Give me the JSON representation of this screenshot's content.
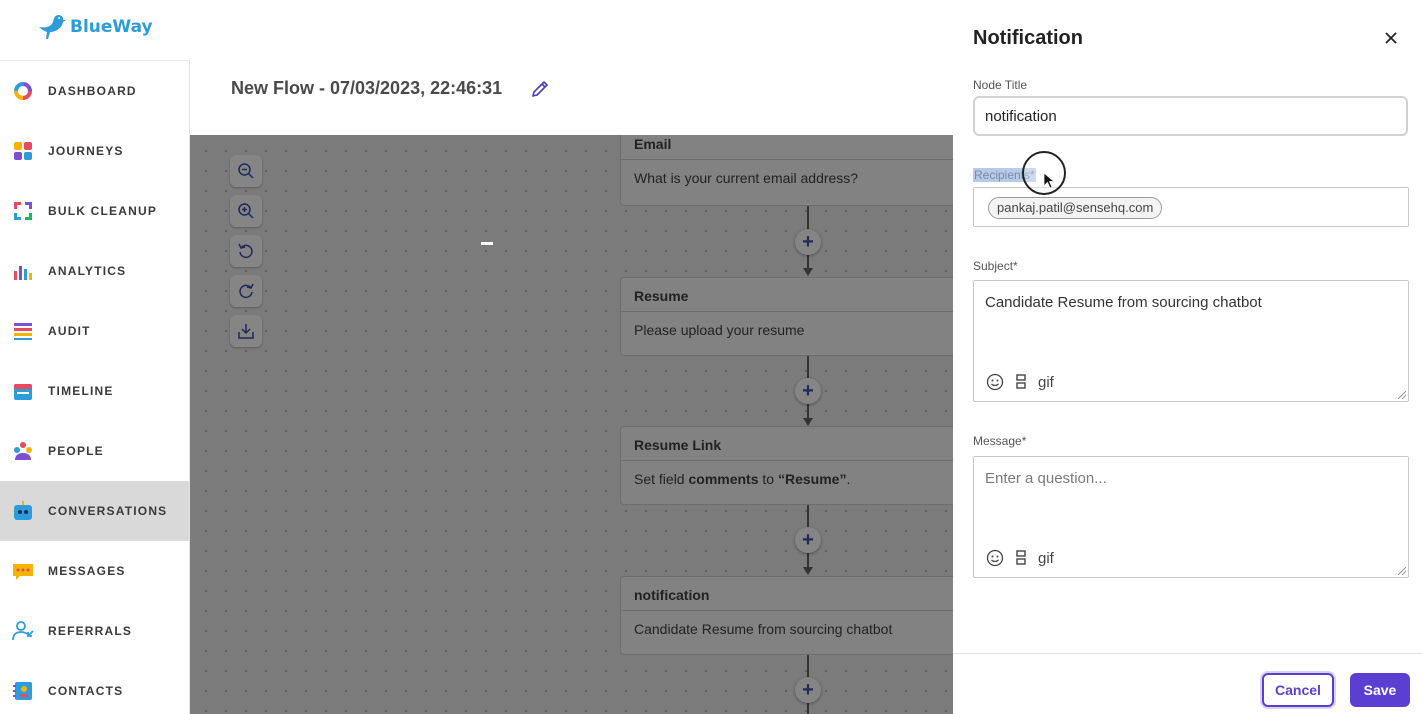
{
  "app": {
    "name": "BlueWay"
  },
  "sidebar": {
    "items": [
      {
        "label": "DASHBOARD",
        "icon": "dashboard-donut-icon"
      },
      {
        "label": "JOURNEYS",
        "icon": "journeys-grid-icon"
      },
      {
        "label": "BULK CLEANUP",
        "icon": "bulk-cleanup-arrows-icon"
      },
      {
        "label": "ANALYTICS",
        "icon": "analytics-bars-icon"
      },
      {
        "label": "AUDIT",
        "icon": "audit-list-icon"
      },
      {
        "label": "TIMELINE",
        "icon": "timeline-calendar-icon"
      },
      {
        "label": "PEOPLE",
        "icon": "people-group-icon"
      },
      {
        "label": "CONVERSATIONS",
        "icon": "conversations-robot-icon",
        "active": true
      },
      {
        "label": "MESSAGES",
        "icon": "messages-bubble-icon"
      },
      {
        "label": "REFERRALS",
        "icon": "referrals-user-icon"
      },
      {
        "label": "CONTACTS",
        "icon": "contacts-book-icon"
      }
    ]
  },
  "header": {
    "flow_title": "New Flow - 07/03/2023, 22:46:31"
  },
  "canvas": {
    "nodes": [
      {
        "title": "Email",
        "body": "What is your current email address?"
      },
      {
        "title": "Resume",
        "body": "Please upload your resume"
      },
      {
        "title": "Resume Link",
        "body_prefix": "Set field ",
        "body_field": "comments",
        "body_mid": " to ",
        "body_value": "“Resume”",
        "body_suffix": "."
      },
      {
        "title": "notification",
        "body": "Candidate Resume from sourcing chatbot"
      }
    ],
    "add_symbol": "+"
  },
  "panel": {
    "title": "Notification",
    "node_title_label": "Node Title",
    "node_title_value": "notification",
    "recipients_label": "Recipients*",
    "recipients": [
      "pankaj.patil@sensehq.com"
    ],
    "subject_label": "Subject*",
    "subject_value": "Candidate Resume from sourcing chatbot",
    "message_label": "Message*",
    "message_placeholder": "Enter a question...",
    "gif_label": "gif",
    "cancel_label": "Cancel",
    "save_label": "Save"
  },
  "colors": {
    "accent": "#5b3fd1",
    "brand": "#2d9cdb",
    "active_nav": "#d9d9d9",
    "overlay_canvas": "#7b7b7b"
  }
}
